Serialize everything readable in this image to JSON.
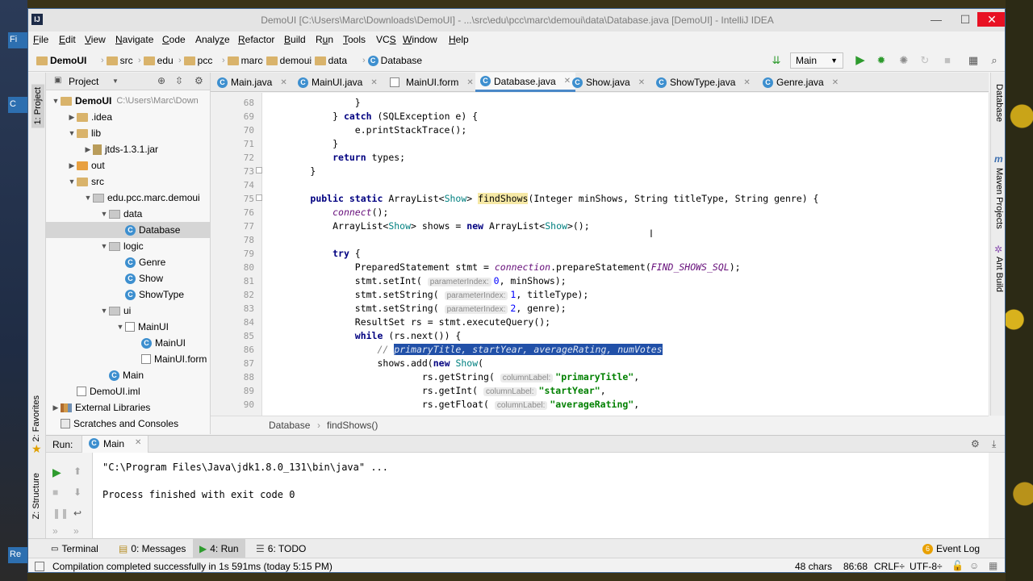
{
  "window": {
    "title": "DemoUI [C:\\Users\\Marc\\Downloads\\DemoUI] - ...\\src\\edu\\pcc\\marc\\demoui\\data\\Database.java [DemoUI] - IntelliJ IDEA",
    "app_icon": "IJ"
  },
  "menu": [
    {
      "label": "File",
      "key": "F"
    },
    {
      "label": "Edit",
      "key": "E"
    },
    {
      "label": "View",
      "key": "V"
    },
    {
      "label": "Navigate",
      "key": "N"
    },
    {
      "label": "Code",
      "key": "C"
    },
    {
      "label": "Analyze",
      "key": "z"
    },
    {
      "label": "Refactor",
      "key": "R"
    },
    {
      "label": "Build",
      "key": "B"
    },
    {
      "label": "Run",
      "key": "u"
    },
    {
      "label": "Tools",
      "key": "T"
    },
    {
      "label": "VCS",
      "key": "S"
    },
    {
      "label": "Window",
      "key": "W"
    },
    {
      "label": "Help",
      "key": "H"
    }
  ],
  "nav": {
    "project": "DemoUI",
    "crumbs": [
      "src",
      "edu",
      "pcc",
      "marc",
      "demoui",
      "data",
      "Database"
    ],
    "run_config": "Main"
  },
  "project_panel": {
    "header": "Project",
    "tree": [
      {
        "label": "DemoUI",
        "extra": "C:\\Users\\Marc\\Down",
        "indent": 0,
        "arrow": "▼",
        "icon": "folder"
      },
      {
        "label": ".idea",
        "indent": 1,
        "arrow": "▶",
        "icon": "folder"
      },
      {
        "label": "lib",
        "indent": 1,
        "arrow": "▼",
        "icon": "folder"
      },
      {
        "label": "jtds-1.3.1.jar",
        "indent": 2,
        "arrow": "▶",
        "icon": "jar"
      },
      {
        "label": "out",
        "indent": 1,
        "arrow": "▶",
        "icon": "folder-orange"
      },
      {
        "label": "src",
        "indent": 1,
        "arrow": "▼",
        "icon": "folder"
      },
      {
        "label": "edu.pcc.marc.demoui",
        "indent": 2,
        "arrow": "▼",
        "icon": "pkg"
      },
      {
        "label": "data",
        "indent": 3,
        "arrow": "▼",
        "icon": "pkg"
      },
      {
        "label": "Database",
        "indent": 4,
        "arrow": "",
        "icon": "class",
        "selected": true
      },
      {
        "label": "logic",
        "indent": 3,
        "arrow": "▼",
        "icon": "pkg"
      },
      {
        "label": "Genre",
        "indent": 4,
        "arrow": "",
        "icon": "class"
      },
      {
        "label": "Show",
        "indent": 4,
        "arrow": "",
        "icon": "class"
      },
      {
        "label": "ShowType",
        "indent": 4,
        "arrow": "",
        "icon": "class"
      },
      {
        "label": "ui",
        "indent": 3,
        "arrow": "▼",
        "icon": "pkg"
      },
      {
        "label": "MainUI",
        "indent": 4,
        "arrow": "▼",
        "icon": "form"
      },
      {
        "label": "MainUI",
        "indent": 5,
        "arrow": "",
        "icon": "class"
      },
      {
        "label": "MainUI.form",
        "indent": 5,
        "arrow": "",
        "icon": "form"
      },
      {
        "label": "Main",
        "indent": 3,
        "arrow": "",
        "icon": "class"
      },
      {
        "label": "DemoUI.iml",
        "indent": 1,
        "arrow": "",
        "icon": "form"
      },
      {
        "label": "External Libraries",
        "indent": 0,
        "arrow": "▶",
        "icon": "lib"
      },
      {
        "label": "Scratches and Consoles",
        "indent": 0,
        "arrow": "",
        "icon": "scratch"
      }
    ]
  },
  "left_stripe": {
    "top_tab": "1: Project",
    "fav_tab": "2: Favorites",
    "struct_tab": "Z: Structure"
  },
  "right_stripe": {
    "database": "Database",
    "maven": "Maven Projects",
    "ant": "Ant Build"
  },
  "tabs": [
    {
      "label": "Main.java",
      "active": false
    },
    {
      "label": "MainUI.java",
      "active": false
    },
    {
      "label": "MainUI.form",
      "active": false
    },
    {
      "label": "Database.java",
      "active": true
    },
    {
      "label": "Show.java",
      "active": false
    },
    {
      "label": "ShowType.java",
      "active": false
    },
    {
      "label": "Genre.java",
      "active": false
    }
  ],
  "editor": {
    "line_numbers": [
      "68",
      "69",
      "70",
      "71",
      "72",
      "73",
      "74",
      "75",
      "76",
      "77",
      "78",
      "79",
      "80",
      "81",
      "82",
      "83",
      "84",
      "85",
      "86",
      "87",
      "88",
      "89",
      "90"
    ],
    "lines": [
      [
        {
          "t": "                }",
          "c": ""
        }
      ],
      [
        {
          "t": "            } ",
          "c": ""
        },
        {
          "t": "catch",
          "c": "kw"
        },
        {
          "t": " (SQLException e) {",
          "c": ""
        }
      ],
      [
        {
          "t": "                e.printStackTrace();",
          "c": ""
        }
      ],
      [
        {
          "t": "            }",
          "c": ""
        }
      ],
      [
        {
          "t": "            ",
          "c": ""
        },
        {
          "t": "return",
          "c": "kw"
        },
        {
          "t": " types;",
          "c": ""
        }
      ],
      [
        {
          "t": "        }",
          "c": ""
        }
      ],
      [
        {
          "t": "",
          "c": ""
        }
      ],
      [
        {
          "t": "        ",
          "c": ""
        },
        {
          "t": "public static",
          "c": "kw"
        },
        {
          "t": " ArrayList<",
          "c": ""
        },
        {
          "t": "Show",
          "c": "ty"
        },
        {
          "t": "> ",
          "c": ""
        },
        {
          "t": "findShows",
          "c": "fn-hl"
        },
        {
          "t": "(Integer minShows, String titleType, String genre) {",
          "c": ""
        }
      ],
      [
        {
          "t": "            ",
          "c": ""
        },
        {
          "t": "connect",
          "c": "it"
        },
        {
          "t": "();",
          "c": ""
        }
      ],
      [
        {
          "t": "            ArrayList<",
          "c": ""
        },
        {
          "t": "Show",
          "c": "ty"
        },
        {
          "t": "> shows = ",
          "c": ""
        },
        {
          "t": "new",
          "c": "kw"
        },
        {
          "t": " ArrayList<",
          "c": ""
        },
        {
          "t": "Show",
          "c": "ty"
        },
        {
          "t": ">();",
          "c": ""
        }
      ],
      [
        {
          "t": "",
          "c": ""
        }
      ],
      [
        {
          "t": "            ",
          "c": ""
        },
        {
          "t": "try",
          "c": "kw"
        },
        {
          "t": " {",
          "c": ""
        }
      ],
      [
        {
          "t": "                PreparedStatement stmt = ",
          "c": ""
        },
        {
          "t": "connection",
          "c": "it"
        },
        {
          "t": ".prepareStatement(",
          "c": ""
        },
        {
          "t": "FIND_SHOWS_SQL",
          "c": "it"
        },
        {
          "t": ");",
          "c": ""
        }
      ],
      [
        {
          "t": "                stmt.setInt( ",
          "c": ""
        },
        {
          "t": "parameterIndex:",
          "c": "hint"
        },
        {
          "t": "0",
          "c": "num"
        },
        {
          "t": ", minShows);",
          "c": ""
        }
      ],
      [
        {
          "t": "                stmt.setString( ",
          "c": ""
        },
        {
          "t": "parameterIndex:",
          "c": "hint"
        },
        {
          "t": "1",
          "c": "num"
        },
        {
          "t": ", titleType);",
          "c": ""
        }
      ],
      [
        {
          "t": "                stmt.setString( ",
          "c": ""
        },
        {
          "t": "parameterIndex:",
          "c": "hint"
        },
        {
          "t": "2",
          "c": "num"
        },
        {
          "t": ", genre);",
          "c": ""
        }
      ],
      [
        {
          "t": "                ResultSet rs = stmt.executeQuery();",
          "c": ""
        }
      ],
      [
        {
          "t": "                ",
          "c": ""
        },
        {
          "t": "while",
          "c": "kw"
        },
        {
          "t": " (rs.next()) {",
          "c": ""
        }
      ],
      [
        {
          "t": "                    ",
          "c": ""
        },
        {
          "t": "// ",
          "c": "com"
        },
        {
          "t": "primaryTitle, startYear, averageRating, numVotes",
          "c": "sel-text"
        }
      ],
      [
        {
          "t": "                    shows.add(",
          "c": ""
        },
        {
          "t": "new",
          "c": "kw"
        },
        {
          "t": " ",
          "c": ""
        },
        {
          "t": "Show",
          "c": "ty"
        },
        {
          "t": "(",
          "c": ""
        }
      ],
      [
        {
          "t": "                            rs.getString( ",
          "c": ""
        },
        {
          "t": "columnLabel:",
          "c": "hint"
        },
        {
          "t": "\"primaryTitle\"",
          "c": "str"
        },
        {
          "t": ",",
          "c": ""
        }
      ],
      [
        {
          "t": "                            rs.getInt( ",
          "c": ""
        },
        {
          "t": "columnLabel:",
          "c": "hint"
        },
        {
          "t": "\"startYear\"",
          "c": "str"
        },
        {
          "t": ",",
          "c": ""
        }
      ],
      [
        {
          "t": "                            rs.getFloat( ",
          "c": ""
        },
        {
          "t": "columnLabel:",
          "c": "hint"
        },
        {
          "t": "\"averageRating\"",
          "c": "str"
        },
        {
          "t": ",",
          "c": ""
        }
      ]
    ]
  },
  "editor_breadcrumb": [
    "Database",
    "findShows()"
  ],
  "run_panel": {
    "label": "Run:",
    "tab": "Main",
    "console": [
      "\"C:\\Program Files\\Java\\jdk1.8.0_131\\bin\\java\" ...",
      "",
      "Process finished with exit code 0"
    ]
  },
  "tool_tabs": [
    {
      "label": "Terminal",
      "active": false
    },
    {
      "label": "0: Messages",
      "active": false
    },
    {
      "label": "4: Run",
      "active": true
    },
    {
      "label": "6: TODO",
      "active": false
    }
  ],
  "event_log": {
    "count": "6",
    "label": "Event Log"
  },
  "status": {
    "message": "Compilation completed successfully in 1s 591ms (today 5:15 PM)",
    "chars": "48 chars",
    "position": "86:68",
    "line_sep": "CRLF÷",
    "encoding": "UTF-8÷"
  },
  "desktop": {
    "left_labels": [
      "Fi",
      "C",
      "Re"
    ]
  },
  "colors": {
    "accent": "#4a88c7",
    "selection": "#2150a8",
    "run_green": "#2e9b2e"
  }
}
